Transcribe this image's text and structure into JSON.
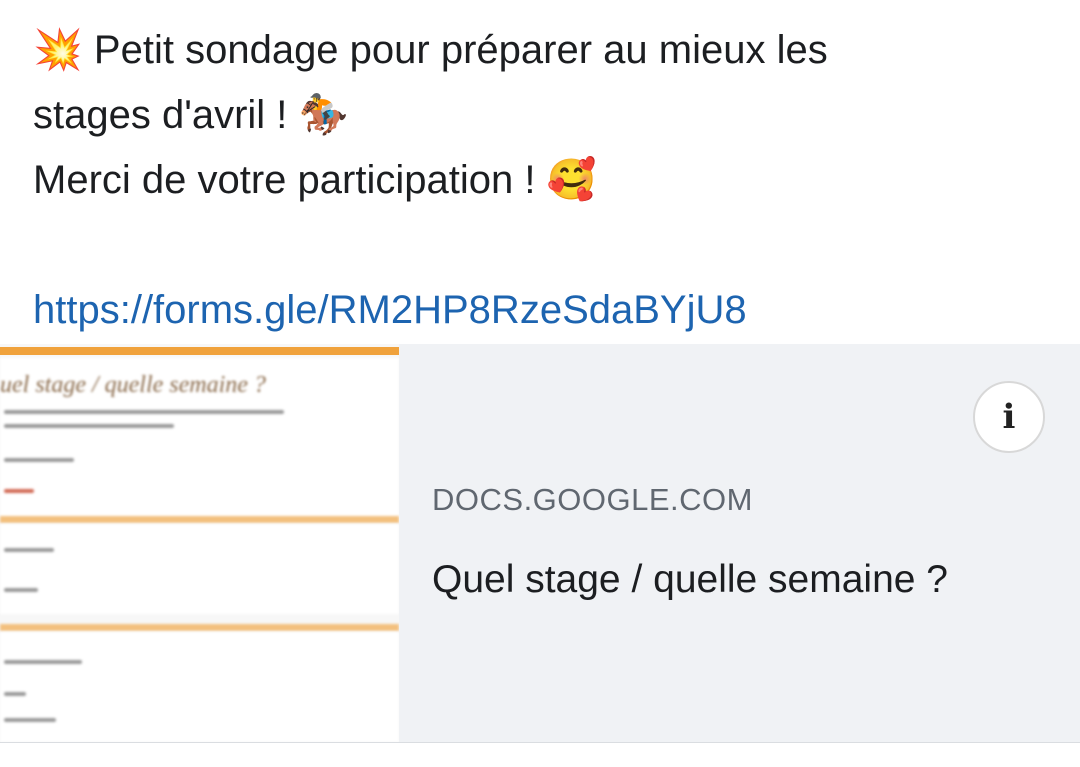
{
  "post": {
    "emoji_sparkle": "💥",
    "line1": " Petit sondage pour préparer au mieux les",
    "line2": "stages d'avril ! ",
    "emoji_horse": "🏇",
    "line3": "Merci de votre participation ! ",
    "emoji_smile": "🥰",
    "link": "https://forms.gle/RM2HP8RzeSdaBYjU8"
  },
  "preview": {
    "thumb_title": "uel stage / quelle semaine ?",
    "info_icon": "i",
    "domain": "DOCS.GOOGLE.COM",
    "title": "Quel stage / quelle semaine ?"
  }
}
